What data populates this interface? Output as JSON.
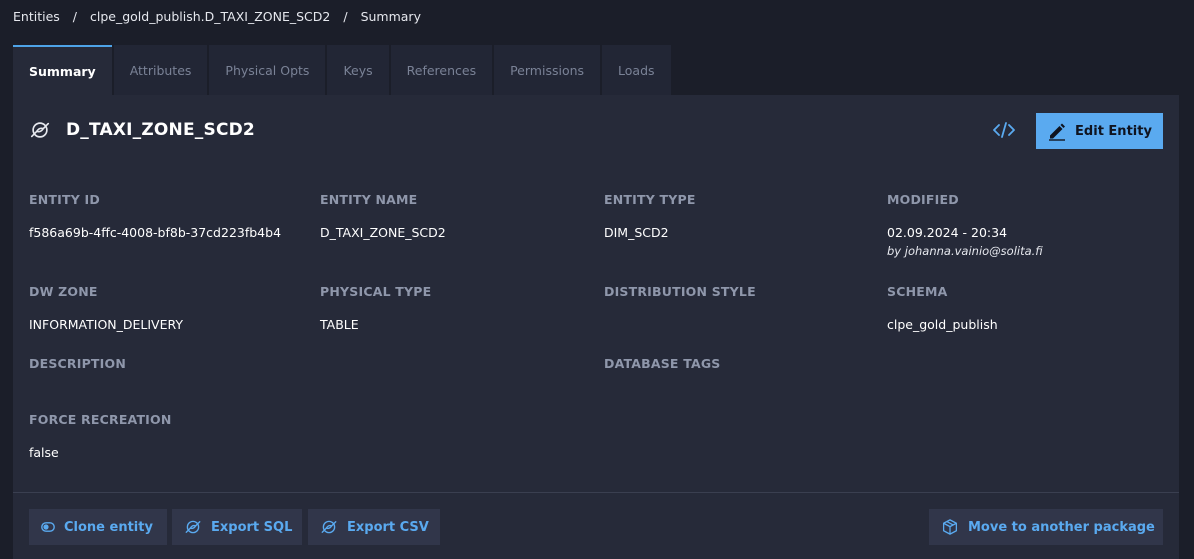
{
  "breadcrumb": {
    "items": [
      "Entities",
      "clpe_gold_publish.D_TAXI_ZONE_SCD2",
      "Summary"
    ],
    "separator": "/"
  },
  "tabs": [
    {
      "label": "Summary",
      "active": true
    },
    {
      "label": "Attributes",
      "active": false
    },
    {
      "label": "Physical Opts",
      "active": false
    },
    {
      "label": "Keys",
      "active": false
    },
    {
      "label": "References",
      "active": false
    },
    {
      "label": "Permissions",
      "active": false
    },
    {
      "label": "Loads",
      "active": false
    }
  ],
  "entity": {
    "title": "D_TAXI_ZONE_SCD2",
    "icon": "entity-icon"
  },
  "header_actions": {
    "code_icon": "code-icon",
    "edit_label": "Edit Entity",
    "edit_icon": "pencil-icon"
  },
  "fields": {
    "entity_id": {
      "label": "ENTITY ID",
      "value": "f586a69b-4ffc-4008-bf8b-37cd223fb4b4"
    },
    "entity_name": {
      "label": "ENTITY NAME",
      "value": "D_TAXI_ZONE_SCD2"
    },
    "entity_type": {
      "label": "ENTITY TYPE",
      "value": "DIM_SCD2"
    },
    "modified": {
      "label": "MODIFIED",
      "value": "02.09.2024 - 20:34",
      "by": "by johanna.vainio@solita.fi"
    },
    "dw_zone": {
      "label": "DW ZONE",
      "value": "INFORMATION_DELIVERY"
    },
    "physical_type": {
      "label": "PHYSICAL TYPE",
      "value": "TABLE"
    },
    "distribution_style": {
      "label": "DISTRIBUTION STYLE",
      "value": ""
    },
    "schema": {
      "label": "SCHEMA",
      "value": "clpe_gold_publish"
    },
    "description": {
      "label": "DESCRIPTION",
      "value": ""
    },
    "database_tags": {
      "label": "DATABASE TAGS",
      "value": ""
    },
    "force_recreation": {
      "label": "FORCE RECREATION",
      "value": "false"
    }
  },
  "actions": {
    "clone": {
      "label": "Clone entity",
      "icon": "toggle-icon"
    },
    "export_sql": {
      "label": "Export SQL",
      "icon": "entity-icon"
    },
    "export_csv": {
      "label": "Export CSV",
      "icon": "entity-icon"
    },
    "move": {
      "label": "Move to another package",
      "icon": "package-icon"
    }
  },
  "colors": {
    "background": "#1b1e29",
    "panel": "#262a39",
    "accent": "#5aaaf0",
    "label": "#8f97ab"
  }
}
